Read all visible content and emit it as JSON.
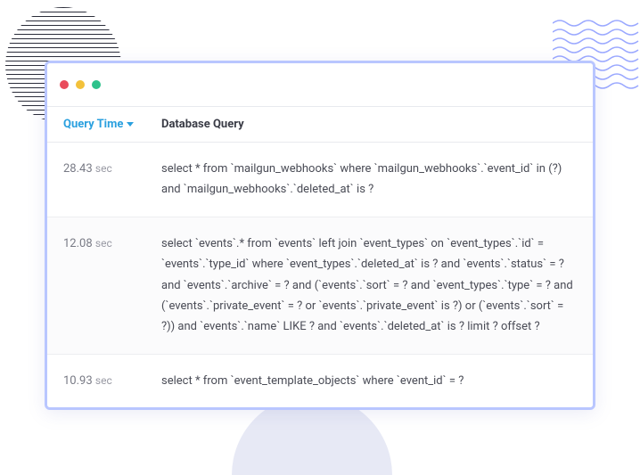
{
  "headers": {
    "query_time": "Query Time",
    "database_query": "Database Query"
  },
  "time_unit": "sec",
  "rows": [
    {
      "time": "28.43",
      "query": "select * from `mailgun_webhooks` where `mailgun_webhooks`.`event_id` in (?) and `mailgun_webhooks`.`deleted_at` is ?"
    },
    {
      "time": "12.08",
      "query": "select `events`.* from `events` left join `event_types` on `event_types`.`id` = `events`.`type_id` where `event_types`.`deleted_at` is ? and `events`.`status` = ? and `events`.`archive` = ? and (`events`.`sort` = ? and `event_types`.`type` = ? and (`events`.`private_event` = ? or `events`.`private_event` is ?) or (`events`.`sort` = ?)) and `events`.`name` LIKE ? and `events`.`deleted_at` is ? limit ? offset ?"
    },
    {
      "time": "10.93",
      "query": "select * from `event_template_objects` where `event_id` = ?"
    }
  ]
}
